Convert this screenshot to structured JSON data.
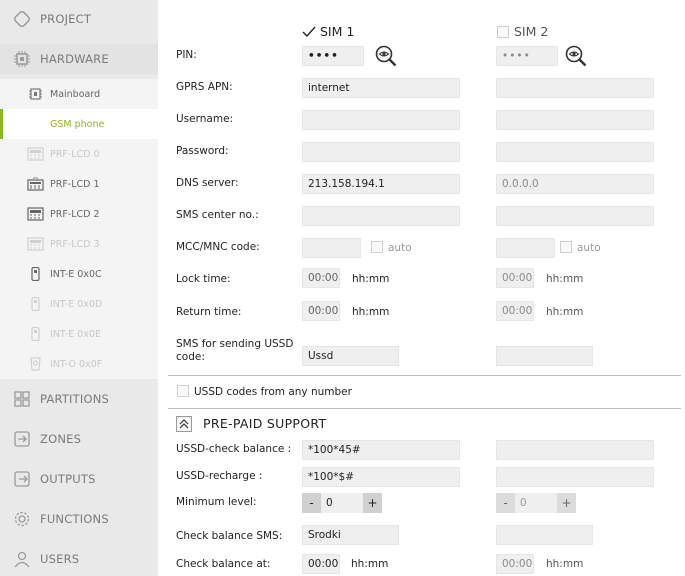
{
  "sidebar": {
    "project": "PROJECT",
    "hardware": "HARDWARE",
    "sub_items": [
      "Mainboard",
      "GSM phone",
      "PRF-LCD 0",
      "PRF-LCD 1",
      "PRF-LCD 2",
      "PRF-LCD 3",
      "INT-E 0x0C",
      "INT-E 0x0D",
      "INT-E 0x0E",
      "INT-O 0x0F"
    ],
    "partitions": "PARTITIONS",
    "zones": "ZONES",
    "outputs": "OUTPUTS",
    "functions": "FUNCTIONS",
    "users": "USERS",
    "accent_color": "#8cb61d"
  },
  "sims": {
    "sim1_label": "SIM 1",
    "sim2_label": "SIM 2",
    "sim1_checked": true,
    "sim2_checked": false
  },
  "labels": {
    "pin": "PIN:",
    "gprs_apn": "GPRS APN:",
    "username": "Username:",
    "password": "Password:",
    "dns_server": "DNS server:",
    "sms_center": "SMS center no.:",
    "mcc_mnc": "MCC/MNC code:",
    "lock_time": "Lock time:",
    "return_time": "Return time:",
    "sms_ussd_line1": "SMS for sending USSD",
    "sms_ussd_line2": "code:",
    "ussd_any_number": "USSD codes from any number",
    "prepaid_title": "PRE-PAID SUPPORT",
    "ussd_check_balance": "USSD-check balance :",
    "ussd_recharge": "USSD-recharge :",
    "minimum_level": "Minimum level:",
    "check_balance_sms": "Check balance SMS:",
    "check_balance_at": "Check balance at:",
    "auto": "auto",
    "hhmm": "hh:mm",
    "minus": "-",
    "plus": "+"
  },
  "sim1": {
    "pin": "••••",
    "gprs_apn": "internet",
    "username": "",
    "password": "",
    "dns_server": "213.158.194.1",
    "sms_center": "",
    "mcc_mnc": "",
    "lock_time": "00:00",
    "return_time": "00:00",
    "sms_ussd": "Ussd",
    "ussd_check_balance": "*100*45#",
    "ussd_recharge": "*100*$#",
    "minimum_level": "0",
    "check_balance_sms": "Srodki",
    "check_balance_at": "00:00"
  },
  "sim2": {
    "pin": "••••",
    "gprs_apn": "",
    "username": "",
    "password": "",
    "dns_server": "0.0.0.0",
    "sms_center": "",
    "mcc_mnc": "",
    "lock_time": "00:00",
    "return_time": "00:00",
    "sms_ussd": "",
    "ussd_check_balance": "",
    "ussd_recharge": "",
    "minimum_level": "0",
    "check_balance_sms": "",
    "check_balance_at": "00:00"
  }
}
